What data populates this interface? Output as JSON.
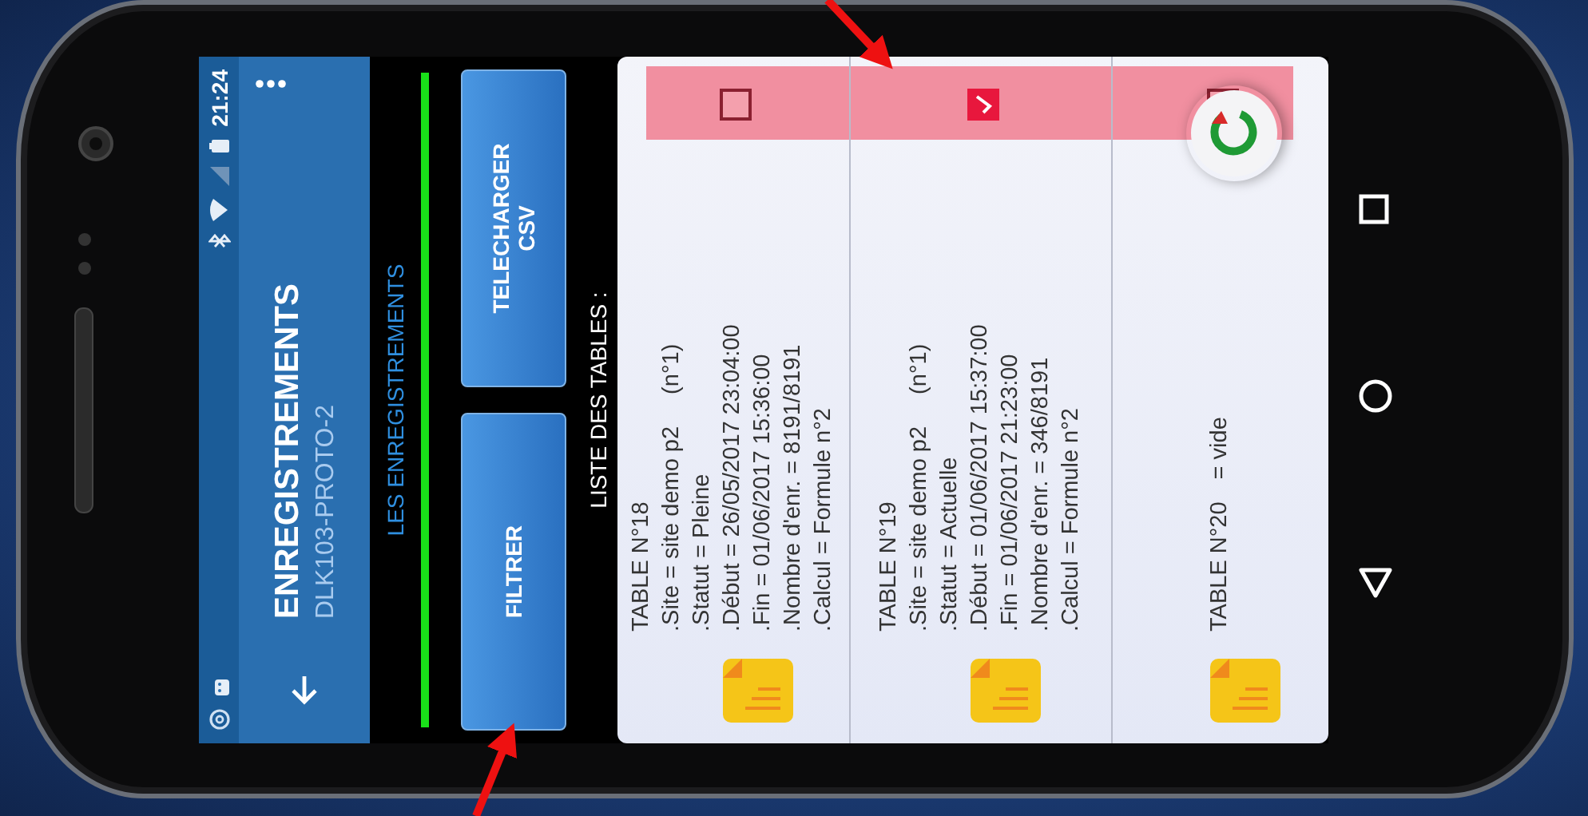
{
  "status_bar": {
    "time": "21:24"
  },
  "app_bar": {
    "title": "ENREGISTREMENTS",
    "subtitle": "DLK103-PROTO-2"
  },
  "tabs": [
    {
      "label": "LES ENREGISTREMENTS",
      "selected": true
    }
  ],
  "buttons": [
    {
      "label": "FILTRER"
    },
    {
      "label": "TELECHARGER CSV"
    }
  ],
  "list_title": "LISTE DES TABLES :",
  "tables": [
    {
      "title": "TABLE N°18",
      "checked": false,
      "lines": [
        {
          "text": ".Site = site demo p2",
          "note": "(n°1)"
        },
        {
          "text": ".Statut = Pleine"
        },
        {
          "text": ".Début = 26/05/2017 23:04:00"
        },
        {
          "text": ".Fin = 01/06/2017 15:36:00"
        },
        {
          "text": ".Nombre d'enr. = 8191/8191"
        },
        {
          "text": ".Calcul = Formule n°2"
        }
      ]
    },
    {
      "title": "TABLE N°19",
      "checked": true,
      "lines": [
        {
          "text": ".Site = site demo p2",
          "note": "(n°1)"
        },
        {
          "text": ".Statut = Actuelle"
        },
        {
          "text": ".Début = 01/06/2017 15:37:00"
        },
        {
          "text": ".Fin = 01/06/2017 21:23:00"
        },
        {
          "text": ".Nombre d'enr. = 346/8191"
        },
        {
          "text": ".Calcul = Formule n°2"
        }
      ]
    },
    {
      "title": "TABLE N°20",
      "status": "= vide",
      "checked": false
    }
  ]
}
